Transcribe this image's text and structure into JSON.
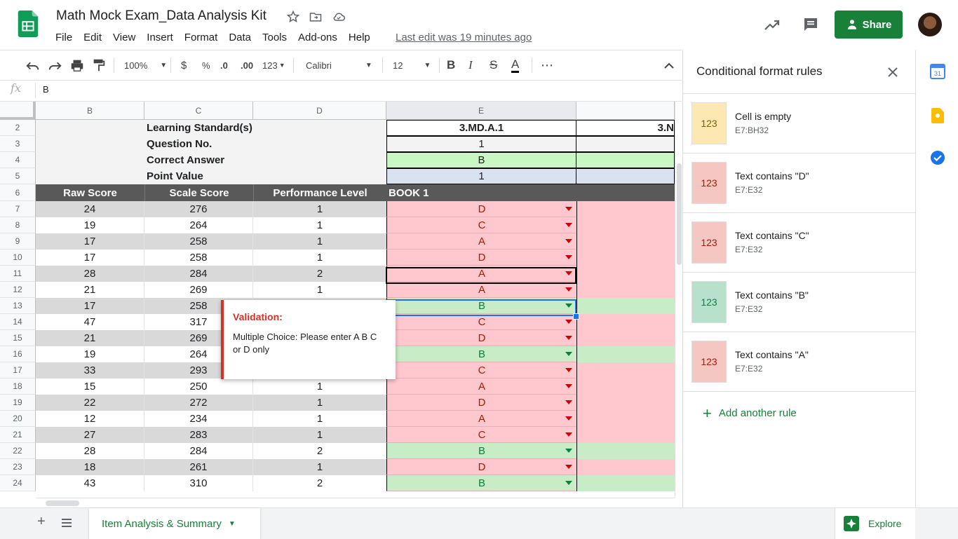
{
  "doc": {
    "title": "Math Mock Exam_Data Analysis Kit"
  },
  "menu": [
    "File",
    "Edit",
    "View",
    "Insert",
    "Format",
    "Data",
    "Tools",
    "Add-ons",
    "Help"
  ],
  "last_edit": "Last edit was 19 minutes ago",
  "share_label": "Share",
  "toolbar": {
    "zoom": "100%",
    "currency": "$",
    "percent": "%",
    "dec_less": ".0",
    "dec_more": ".00",
    "num_format": "123",
    "font": "Calibri",
    "size": "12",
    "bold": "B",
    "italic": "I",
    "strike": "S",
    "textcolor": "A",
    "more": "⋯"
  },
  "formula": {
    "fx": "fx",
    "value": "B"
  },
  "columns": [
    "B",
    "C",
    "D",
    "E"
  ],
  "header_rows": [
    {
      "num": "2",
      "label": "Learning Standard(s)",
      "e": "3.MD.A.1",
      "f": "3.N"
    },
    {
      "num": "3",
      "label": "Question No.",
      "e": "1",
      "f": ""
    },
    {
      "num": "4",
      "label": "Correct Answer",
      "e": "B",
      "f": ""
    },
    {
      "num": "5",
      "label": "Point Value",
      "e": "1",
      "f": ""
    }
  ],
  "table_header": {
    "num": "6",
    "b": "Raw Score",
    "c": "Scale Score",
    "d": "Performance Level",
    "e": "BOOK 1"
  },
  "rows": [
    {
      "num": "7",
      "b": "24",
      "c": "276",
      "d": "1",
      "e": "D"
    },
    {
      "num": "8",
      "b": "19",
      "c": "264",
      "d": "1",
      "e": "C"
    },
    {
      "num": "9",
      "b": "17",
      "c": "258",
      "d": "1",
      "e": "A"
    },
    {
      "num": "10",
      "b": "17",
      "c": "258",
      "d": "1",
      "e": "D"
    },
    {
      "num": "11",
      "b": "28",
      "c": "284",
      "d": "2",
      "e": "A"
    },
    {
      "num": "12",
      "b": "21",
      "c": "269",
      "d": "1",
      "e": "A"
    },
    {
      "num": "13",
      "b": "17",
      "c": "258",
      "d": "",
      "e": "B"
    },
    {
      "num": "14",
      "b": "47",
      "c": "317",
      "d": "",
      "e": "C"
    },
    {
      "num": "15",
      "b": "21",
      "c": "269",
      "d": "",
      "e": "D"
    },
    {
      "num": "16",
      "b": "19",
      "c": "264",
      "d": "",
      "e": "B"
    },
    {
      "num": "17",
      "b": "33",
      "c": "293",
      "d": "",
      "e": "C"
    },
    {
      "num": "18",
      "b": "15",
      "c": "250",
      "d": "1",
      "e": "A"
    },
    {
      "num": "19",
      "b": "22",
      "c": "272",
      "d": "1",
      "e": "D"
    },
    {
      "num": "20",
      "b": "12",
      "c": "234",
      "d": "1",
      "e": "A"
    },
    {
      "num": "21",
      "b": "27",
      "c": "283",
      "d": "1",
      "e": "C"
    },
    {
      "num": "22",
      "b": "28",
      "c": "284",
      "d": "2",
      "e": "B"
    },
    {
      "num": "23",
      "b": "18",
      "c": "261",
      "d": "1",
      "e": "D"
    },
    {
      "num": "24",
      "b": "43",
      "c": "310",
      "d": "2",
      "e": "B"
    }
  ],
  "validation": {
    "title": "Validation:",
    "message": "Multiple Choice: Please enter A B C or D only"
  },
  "panel": {
    "title": "Conditional format rules",
    "rules": [
      {
        "title": "Cell is empty",
        "range": "E7:BH32",
        "sample": "123",
        "bg": "#fce8b2",
        "fg": "#7f6000"
      },
      {
        "title": "Text contains \"D\"",
        "range": "E7:E32",
        "sample": "123",
        "bg": "#f4c7c3",
        "fg": "#a61c00"
      },
      {
        "title": "Text contains \"C\"",
        "range": "E7:E32",
        "sample": "123",
        "bg": "#f4c7c3",
        "fg": "#a61c00"
      },
      {
        "title": "Text contains \"B\"",
        "range": "E7:E32",
        "sample": "123",
        "bg": "#b7e1cd",
        "fg": "#0b8043"
      },
      {
        "title": "Text contains \"A\"",
        "range": "E7:E32",
        "sample": "123",
        "bg": "#f4c7c3",
        "fg": "#a61c00"
      }
    ],
    "add_rule": "Add another rule"
  },
  "sheet_tab": "Item Analysis & Summary",
  "explore": "Explore",
  "colors": {
    "accent": "#188038",
    "correct": "#c8ecc6",
    "wrong": "#ffc7ce",
    "dark_header": "#595959"
  }
}
